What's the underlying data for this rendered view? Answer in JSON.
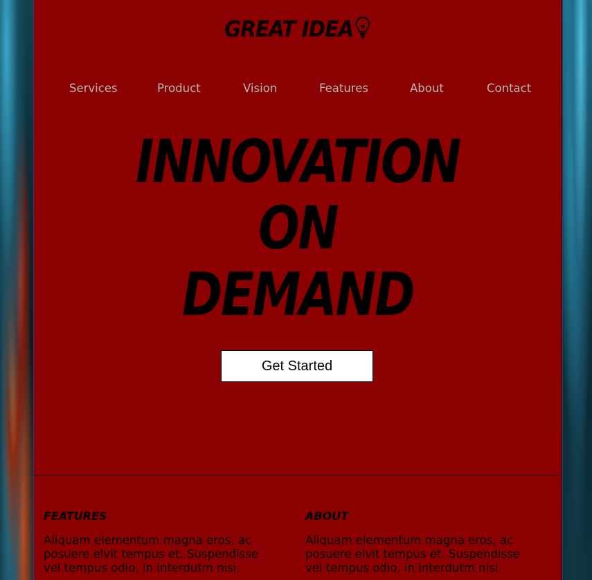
{
  "brand": {
    "logo_text": "GREAT IDEA"
  },
  "nav": {
    "items": [
      {
        "label": "Services"
      },
      {
        "label": "Product"
      },
      {
        "label": "Vision"
      },
      {
        "label": "Features"
      },
      {
        "label": "About"
      },
      {
        "label": "Contact"
      }
    ]
  },
  "hero": {
    "lines": [
      "INNOVATION",
      "ON",
      "DEMAND"
    ],
    "cta_label": "Get Started"
  },
  "sections": [
    {
      "heading": "FEATURES",
      "body": "Aliquam elementum magna eros, ac posuere elvit tempus et. Suspendisse vel tempus odio, in interdutm nisi."
    },
    {
      "heading": "ABOUT",
      "body": "Aliquam elementum magna eros, ac posuere elvit tempus et. Suspendisse vel tempus odio, in interdutm nisi."
    }
  ],
  "colors": {
    "page_background": "#8b0000",
    "nav_text": "#b8b8b8",
    "headline": "#000000",
    "button_background": "#ffffff"
  }
}
